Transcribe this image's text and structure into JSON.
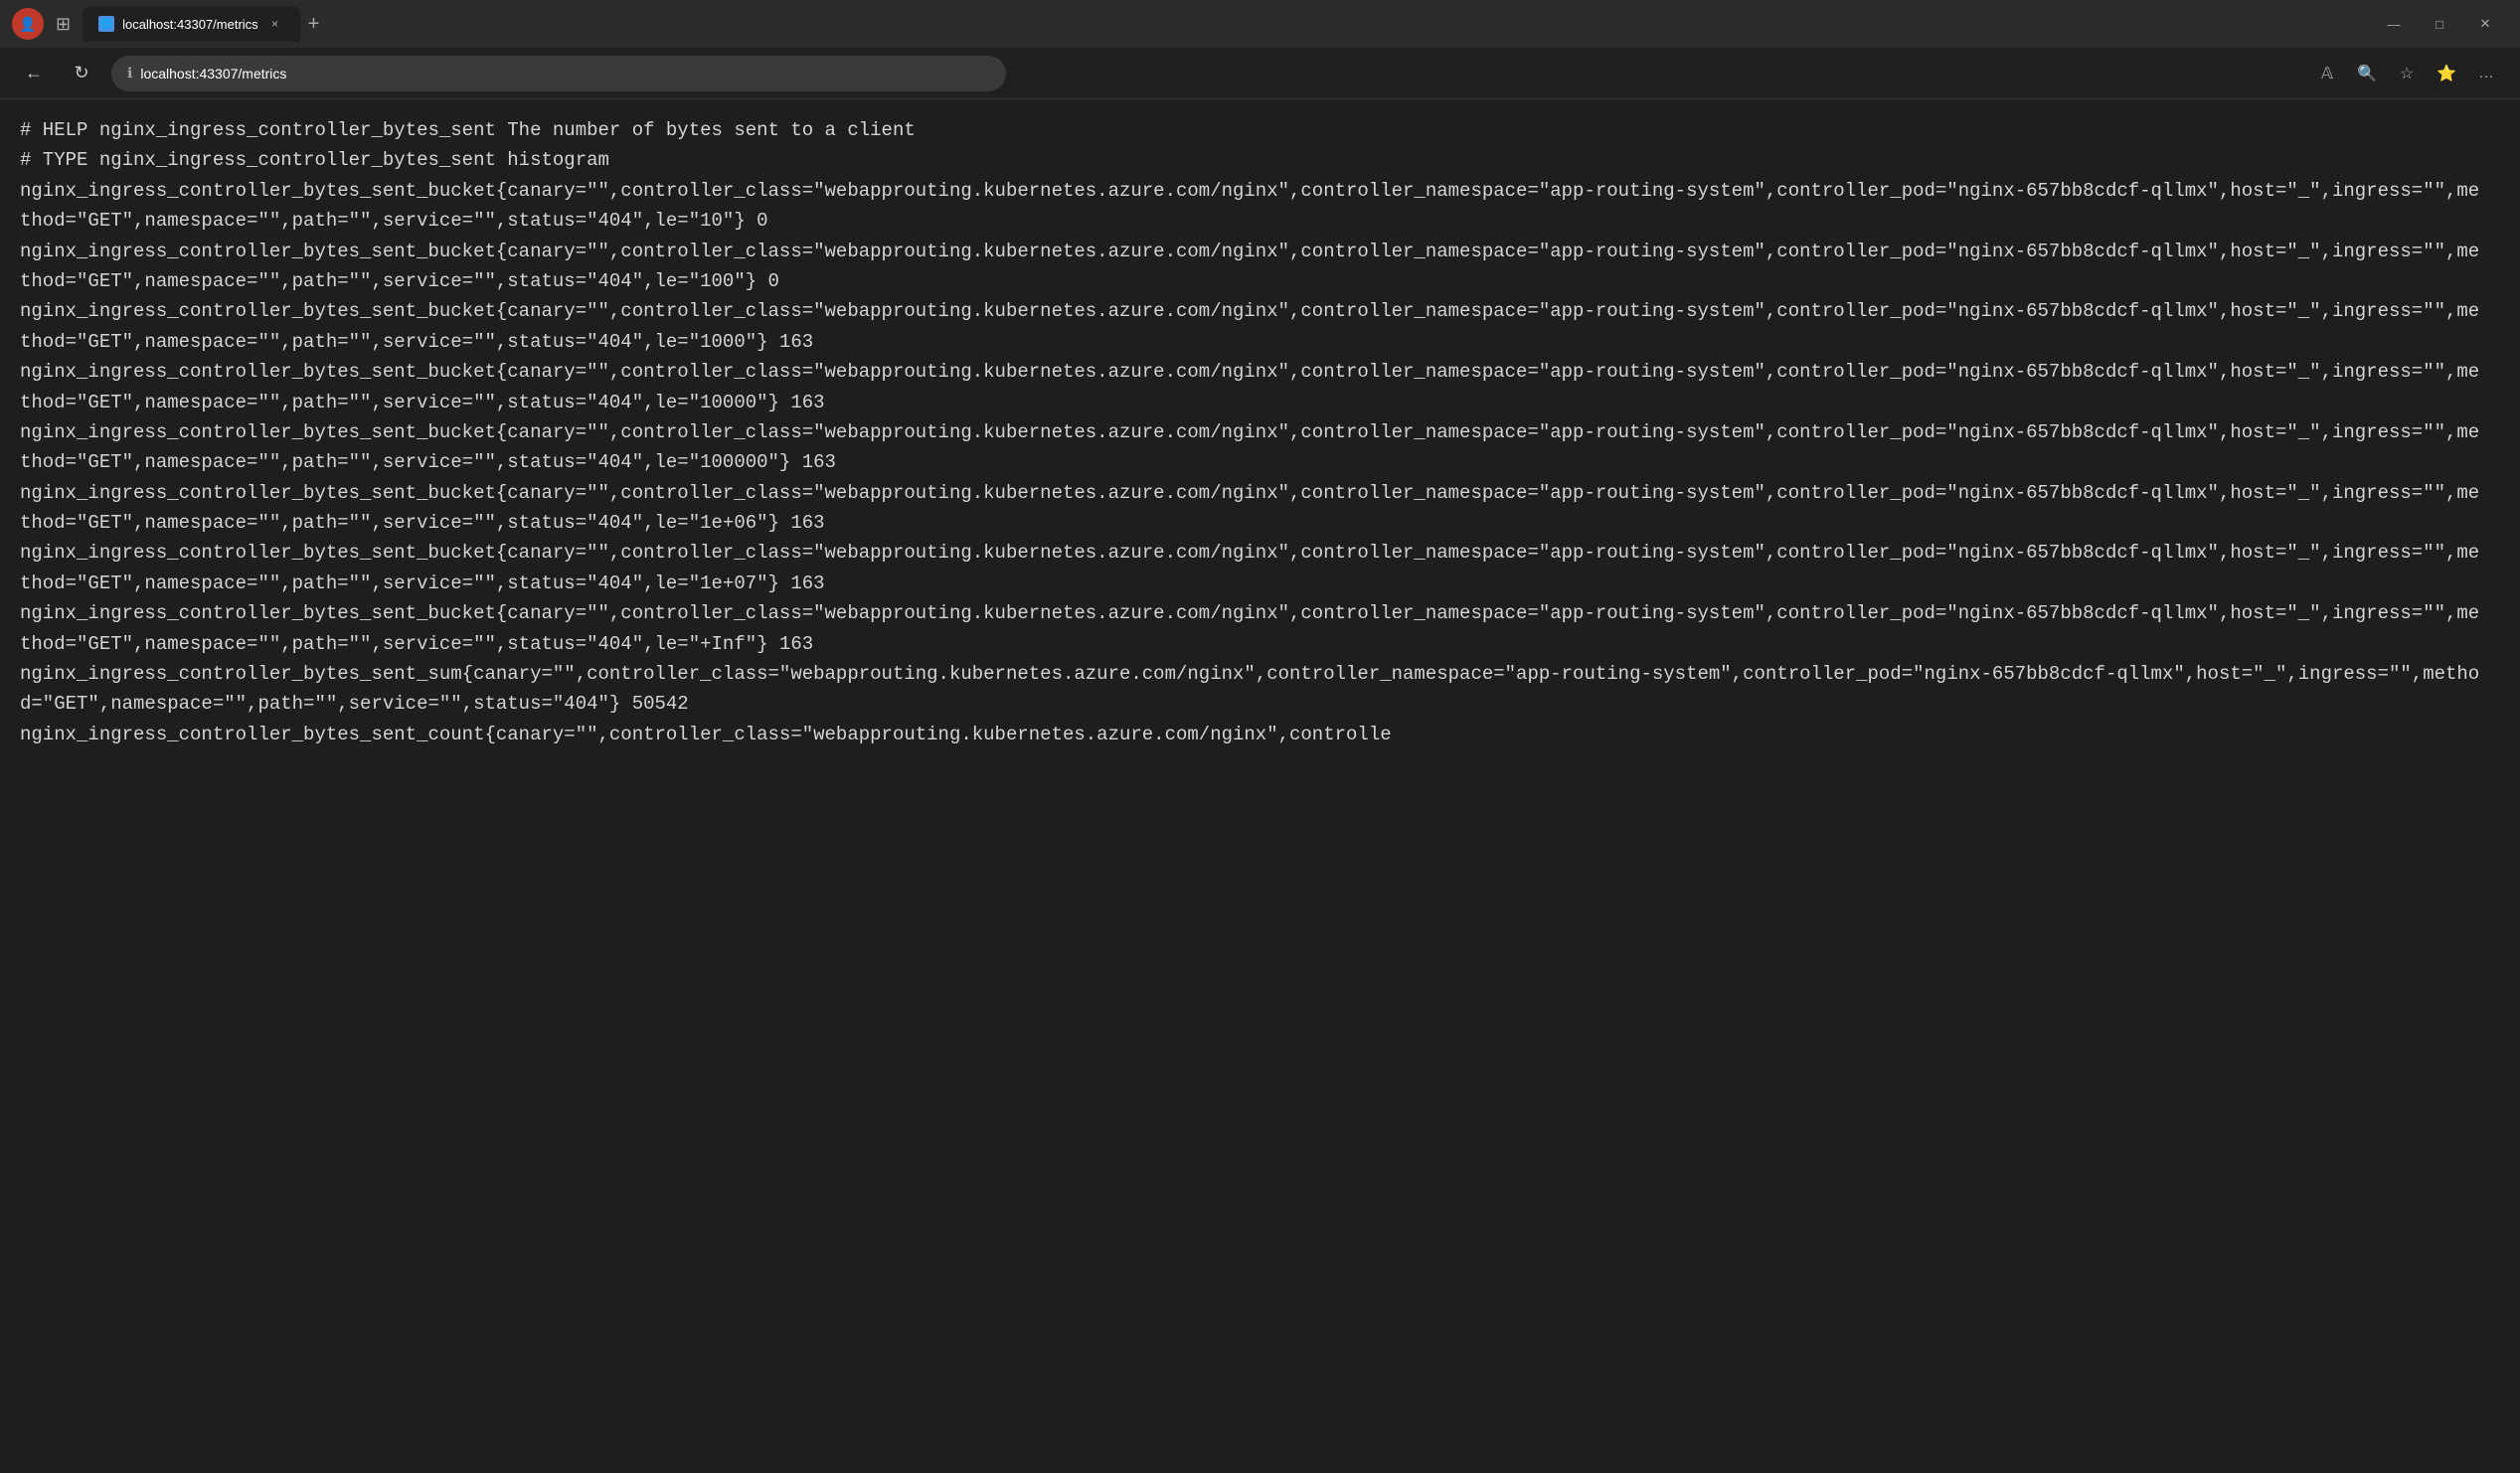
{
  "browser": {
    "title": "localhost:43307/metrics",
    "url": "localhost:43307/metrics",
    "tab_label": "localhost:43307/metrics",
    "tab_close": "×",
    "tab_new": "+",
    "back_icon": "←",
    "forward_icon": "→",
    "refresh_icon": "↻",
    "info_icon": "ℹ",
    "reader_icon": "📖",
    "zoom_icon": "🔍",
    "favorites_icon": "☆",
    "collections_icon": "⭐",
    "more_icon": "…",
    "minimize": "—",
    "maximize": "□",
    "close": "✕"
  },
  "content": {
    "metrics_text": "# HELP nginx_ingress_controller_bytes_sent The number of bytes sent to a client\n# TYPE nginx_ingress_controller_bytes_sent histogram\nnginx_ingress_controller_bytes_sent_bucket{canary=\"\",controller_class=\"webapprouting.kubernetes.azure.com/nginx\",controller_namespace=\"app-routing-system\",controller_pod=\"nginx-657bb8cdcf-qllmx\",host=\"_\",ingress=\"\",method=\"GET\",namespace=\"\",path=\"\",service=\"\",status=\"404\",le=\"10\"} 0\nnginx_ingress_controller_bytes_sent_bucket{canary=\"\",controller_class=\"webapprouting.kubernetes.azure.com/nginx\",controller_namespace=\"app-routing-system\",controller_pod=\"nginx-657bb8cdcf-qllmx\",host=\"_\",ingress=\"\",method=\"GET\",namespace=\"\",path=\"\",service=\"\",status=\"404\",le=\"100\"} 0\nnginx_ingress_controller_bytes_sent_bucket{canary=\"\",controller_class=\"webapprouting.kubernetes.azure.com/nginx\",controller_namespace=\"app-routing-system\",controller_pod=\"nginx-657bb8cdcf-qllmx\",host=\"_\",ingress=\"\",method=\"GET\",namespace=\"\",path=\"\",service=\"\",status=\"404\",le=\"1000\"} 163\nnginx_ingress_controller_bytes_sent_bucket{canary=\"\",controller_class=\"webapprouting.kubernetes.azure.com/nginx\",controller_namespace=\"app-routing-system\",controller_pod=\"nginx-657bb8cdcf-qllmx\",host=\"_\",ingress=\"\",method=\"GET\",namespace=\"\",path=\"\",service=\"\",status=\"404\",le=\"10000\"} 163\nnginx_ingress_controller_bytes_sent_bucket{canary=\"\",controller_class=\"webapprouting.kubernetes.azure.com/nginx\",controller_namespace=\"app-routing-system\",controller_pod=\"nginx-657bb8cdcf-qllmx\",host=\"_\",ingress=\"\",method=\"GET\",namespace=\"\",path=\"\",service=\"\",status=\"404\",le=\"100000\"} 163\nnginx_ingress_controller_bytes_sent_bucket{canary=\"\",controller_class=\"webapprouting.kubernetes.azure.com/nginx\",controller_namespace=\"app-routing-system\",controller_pod=\"nginx-657bb8cdcf-qllmx\",host=\"_\",ingress=\"\",method=\"GET\",namespace=\"\",path=\"\",service=\"\",status=\"404\",le=\"1e+06\"} 163\nnginx_ingress_controller_bytes_sent_bucket{canary=\"\",controller_class=\"webapprouting.kubernetes.azure.com/nginx\",controller_namespace=\"app-routing-system\",controller_pod=\"nginx-657bb8cdcf-qllmx\",host=\"_\",ingress=\"\",method=\"GET\",namespace=\"\",path=\"\",service=\"\",status=\"404\",le=\"1e+07\"} 163\nnginx_ingress_controller_bytes_sent_bucket{canary=\"\",controller_class=\"webapprouting.kubernetes.azure.com/nginx\",controller_namespace=\"app-routing-system\",controller_pod=\"nginx-657bb8cdcf-qllmx\",host=\"_\",ingress=\"\",method=\"GET\",namespace=\"\",path=\"\",service=\"\",status=\"404\",le=\"+Inf\"} 163\nnginx_ingress_controller_bytes_sent_sum{canary=\"\",controller_class=\"webapprouting.kubernetes.azure.com/nginx\",controller_namespace=\"app-routing-system\",controller_pod=\"nginx-657bb8cdcf-qllmx\",host=\"_\",ingress=\"\",method=\"GET\",namespace=\"\",path=\"\",service=\"\",status=\"404\"} 50542\nnginx_ingress_controller_bytes_sent_count{canary=\"\",controller_class=\"webapprouting.kubernetes.azure.com/nginx\",controlle"
  }
}
